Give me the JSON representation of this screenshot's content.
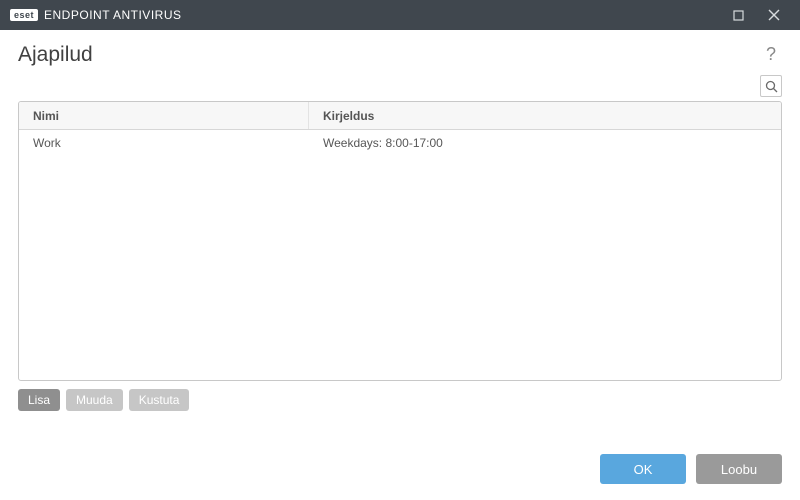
{
  "window": {
    "brand_badge": "eset",
    "product_name": "ENDPOINT ANTIVIRUS"
  },
  "page": {
    "title": "Ajapilud"
  },
  "table": {
    "columns": {
      "name": "Nimi",
      "description": "Kirjeldus"
    },
    "rows": [
      {
        "name": "Work",
        "description": "Weekdays: 8:00-17:00"
      }
    ]
  },
  "toolbar": {
    "add": "Lisa",
    "edit": "Muuda",
    "delete": "Kustuta"
  },
  "footer": {
    "ok": "OK",
    "cancel": "Loobu"
  }
}
